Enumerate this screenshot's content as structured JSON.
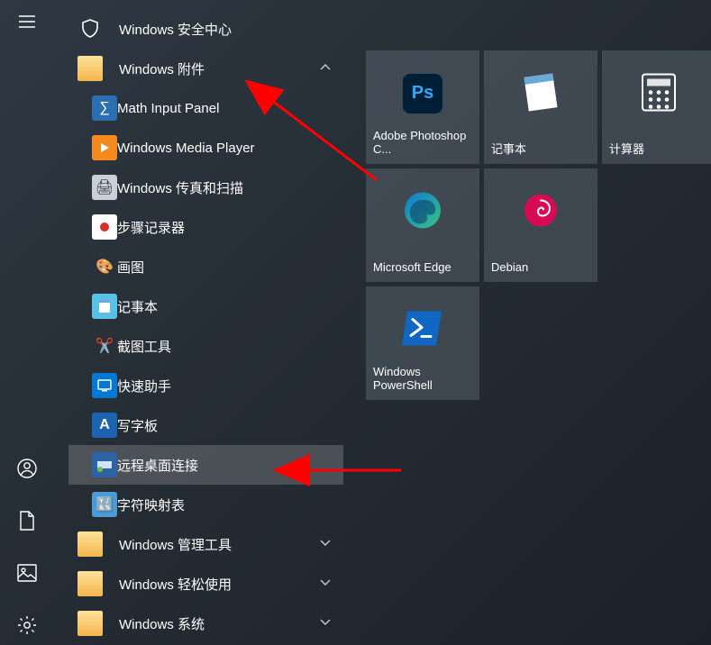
{
  "rail": {
    "hamburger": "menu",
    "user": "user",
    "documents": "documents",
    "pictures": "pictures",
    "settings": "settings"
  },
  "list": {
    "security": "Windows 安全中心",
    "accessories": "Windows 附件",
    "math": "Math Input Panel",
    "wmp": "Windows Media Player",
    "fax": "Windows 传真和扫描",
    "steps": "步骤记录器",
    "paint": "画图",
    "notepad": "记事本",
    "snip": "截图工具",
    "quick": "快速助手",
    "wordpad": "写字板",
    "rdp": "远程桌面连接",
    "charmap": "字符映射表",
    "admintools": "Windows 管理工具",
    "ease": "Windows 轻松使用",
    "system": "Windows 系统"
  },
  "tiles": {
    "ps": "Adobe Photoshop C...",
    "notepad": "记事本",
    "calc": "计算器",
    "edge": "Microsoft Edge",
    "debian": "Debian",
    "powershell": "Windows\nPowerShell"
  },
  "colors": {
    "psBlue": "#001e36",
    "psLetter": "#31a8ff",
    "edge1": "#0f79d0",
    "edge2": "#36c485",
    "debian": "#d70a53",
    "pwsh": "#0f66c3"
  }
}
